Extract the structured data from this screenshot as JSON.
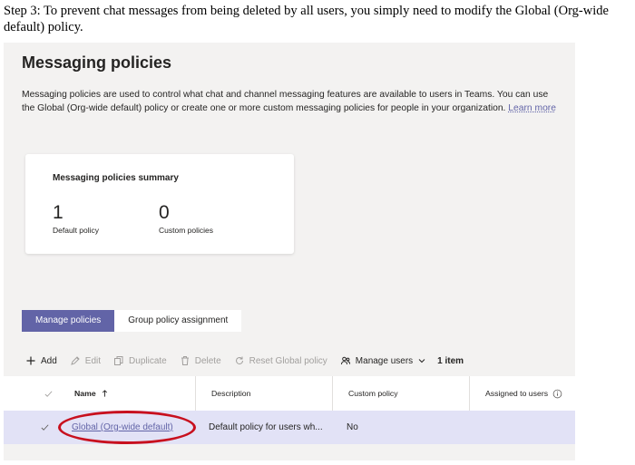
{
  "instruction": "Step 3: To prevent chat messages from being deleted by all users, you simply need to modify the Global (Org-wide default) policy.",
  "page": {
    "title": "Messaging policies",
    "description": "Messaging policies are used to control what chat and channel messaging features are available to users in Teams. You can use the Global (Org-wide default) policy or create one or more custom messaging policies for people in your organization.",
    "learn_more": "Learn more"
  },
  "summary": {
    "title": "Messaging policies summary",
    "default_count": "1",
    "default_label": "Default policy",
    "custom_count": "0",
    "custom_label": "Custom policies"
  },
  "tabs": [
    {
      "label": "Manage policies",
      "active": true
    },
    {
      "label": "Group policy assignment",
      "active": false
    }
  ],
  "toolbar": {
    "add": "Add",
    "edit": "Edit",
    "duplicate": "Duplicate",
    "delete": "Delete",
    "reset": "Reset Global policy",
    "manage_users": "Manage users",
    "count": "1 item"
  },
  "table": {
    "columns": {
      "name": "Name",
      "description": "Description",
      "custom_policy": "Custom policy",
      "assigned": "Assigned to users"
    },
    "rows": [
      {
        "name": "Global (Org-wide default)",
        "description": "Default policy for users wh...",
        "custom_policy": "No",
        "assigned": ""
      }
    ]
  },
  "colors": {
    "accent": "#6264a7",
    "panel_bg": "#f3f2f1",
    "selected_row": "#e2e2f6",
    "highlight": "#c8101e"
  }
}
